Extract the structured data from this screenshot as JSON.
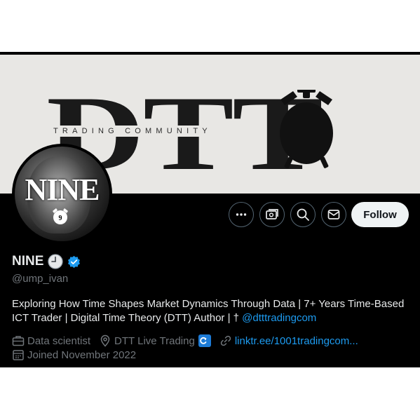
{
  "banner": {
    "logo_letters": "DTT",
    "logo_subtitle": "TRADING COMMUNITY"
  },
  "avatar": {
    "text": "NINE"
  },
  "actions": {
    "more_icon": "more-horizontal-icon",
    "subscribe_icon": "money-icon",
    "search_icon": "search-icon",
    "message_icon": "mail-icon",
    "follow_label": "Follow"
  },
  "profile": {
    "display_name": "NINE",
    "name_emoji": "clock-emoji",
    "verified_icon": "verified-badge-icon",
    "handle": "@ump_ivan",
    "bio_text": "Exploring How Time Shapes Market Dynamics Through Data | 7+ Years Time-Based ICT Trader | Digital Time Theory (DTT) Author | † ",
    "bio_link": "@dtttradingcom",
    "profession": "Data scientist",
    "location": "DTT Live Trading",
    "website": "linktr.ee/1001tradingcom...",
    "joined": "Joined November 2022"
  },
  "colors": {
    "background": "#000000",
    "banner": "#e8e7e4",
    "text_primary": "#e7e9ea",
    "text_secondary": "#71767b",
    "link": "#1d9bf0",
    "follow_button_bg": "#eff3f4"
  }
}
